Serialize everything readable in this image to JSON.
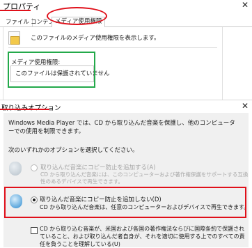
{
  "properties": {
    "title": "プロパティ",
    "close_glyph": "✕",
    "tabs": [
      {
        "label": "ファイル"
      },
      {
        "label": "コンテンツ"
      },
      {
        "label": "メディア使用権限"
      }
    ],
    "description": "このファイルのメディア使用権限を表示します。",
    "rights_label": "メディア使用権限:",
    "rights_value": "このファイルは保護されていません"
  },
  "import_options": {
    "title": "取り込みオプション",
    "close_glyph": "✕",
    "description": "Windows Media Player では、CD から取り込んだ音楽を保護し、他のコンピューターでの使用を制限できます。",
    "prompt": "次のいずれかのオプションを選択してください。",
    "options": [
      {
        "label": "取り込んだ音楽にコピー防止を追加する(A)",
        "description": "CD から取り込んだ音楽には、このコンピューターおよび著作権保護をサポートする互換性のあるデバイスで再生できます。",
        "selected": false,
        "enabled": false
      },
      {
        "label": "取り込んだ音楽にコピー防止を追加しない(D)",
        "description": "CD から取り込んだ音楽は、任意のコンピューターおよびデバイスで再生できます。",
        "selected": true,
        "enabled": true
      }
    ],
    "checkbox_label": "CD から取り込む音楽が、米国および各国の著作権法ならびに国際条約で保護されていること、および取り込んだ者自身が、それを適切に使用する上でのすべての責任を負うことを理解している(U)",
    "checkbox_checked": false
  },
  "annotations": {
    "red": "#e0101a",
    "green": "#23a94a"
  }
}
